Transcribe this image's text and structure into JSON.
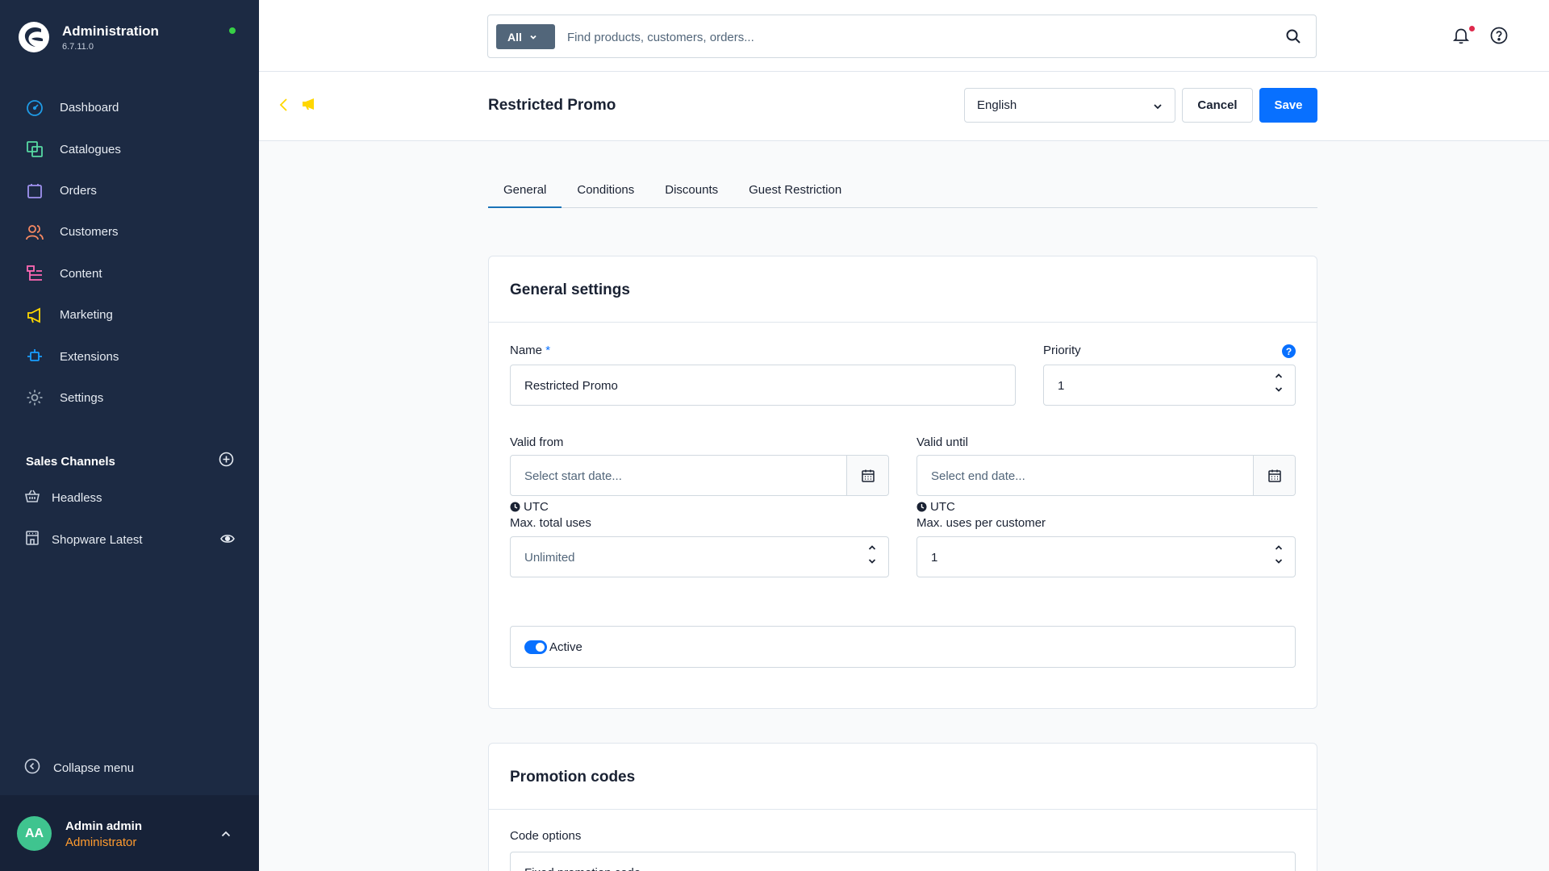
{
  "app": {
    "title": "Administration",
    "version": "6.7.11.0"
  },
  "sidebar": {
    "items": [
      {
        "label": "Dashboard",
        "icon": "dashboard-icon",
        "color": "#1f9be6"
      },
      {
        "label": "Catalogues",
        "icon": "catalogue-icon",
        "color": "#57d9a3"
      },
      {
        "label": "Orders",
        "icon": "orders-icon",
        "color": "#a092f0"
      },
      {
        "label": "Customers",
        "icon": "customers-icon",
        "color": "#f88962"
      },
      {
        "label": "Content",
        "icon": "content-icon",
        "color": "#ff68b4"
      },
      {
        "label": "Marketing",
        "icon": "marketing-icon",
        "color": "#ffd700"
      },
      {
        "label": "Extensions",
        "icon": "extensions-icon",
        "color": "#189eff"
      },
      {
        "label": "Settings",
        "icon": "settings-icon",
        "color": "#9aa8b5"
      }
    ],
    "sales_channels_title": "Sales Channels",
    "sales_channels": [
      {
        "label": "Headless",
        "icon": "basket-icon"
      },
      {
        "label": "Shopware Latest",
        "icon": "storefront-icon"
      }
    ],
    "collapse_label": "Collapse menu"
  },
  "user": {
    "initials": "AA",
    "name": "Admin admin",
    "role": "Administrator"
  },
  "search": {
    "type_label": "All",
    "placeholder": "Find products, customers, orders..."
  },
  "header": {
    "title": "Restricted Promo",
    "language": "English",
    "cancel_label": "Cancel",
    "save_label": "Save"
  },
  "tabs": [
    {
      "label": "General",
      "active": true
    },
    {
      "label": "Conditions",
      "active": false
    },
    {
      "label": "Discounts",
      "active": false
    },
    {
      "label": "Guest Restriction",
      "active": false
    }
  ],
  "general": {
    "title": "General settings",
    "name_label": "Name",
    "name_required": "*",
    "name_value": "Restricted Promo",
    "priority_label": "Priority",
    "priority_help": "?",
    "priority_value": "1",
    "valid_from_label": "Valid from",
    "valid_from_placeholder": "Select start date...",
    "valid_until_label": "Valid until",
    "valid_until_placeholder": "Select end date...",
    "timezone": "UTC",
    "max_total_label": "Max. total uses",
    "max_total_placeholder": "Unlimited",
    "max_customer_label": "Max. uses per customer",
    "max_customer_value": "1",
    "active_label": "Active",
    "active": true
  },
  "codes": {
    "title": "Promotion codes",
    "options_label": "Code options",
    "options_value": "Fixed promotion code"
  }
}
